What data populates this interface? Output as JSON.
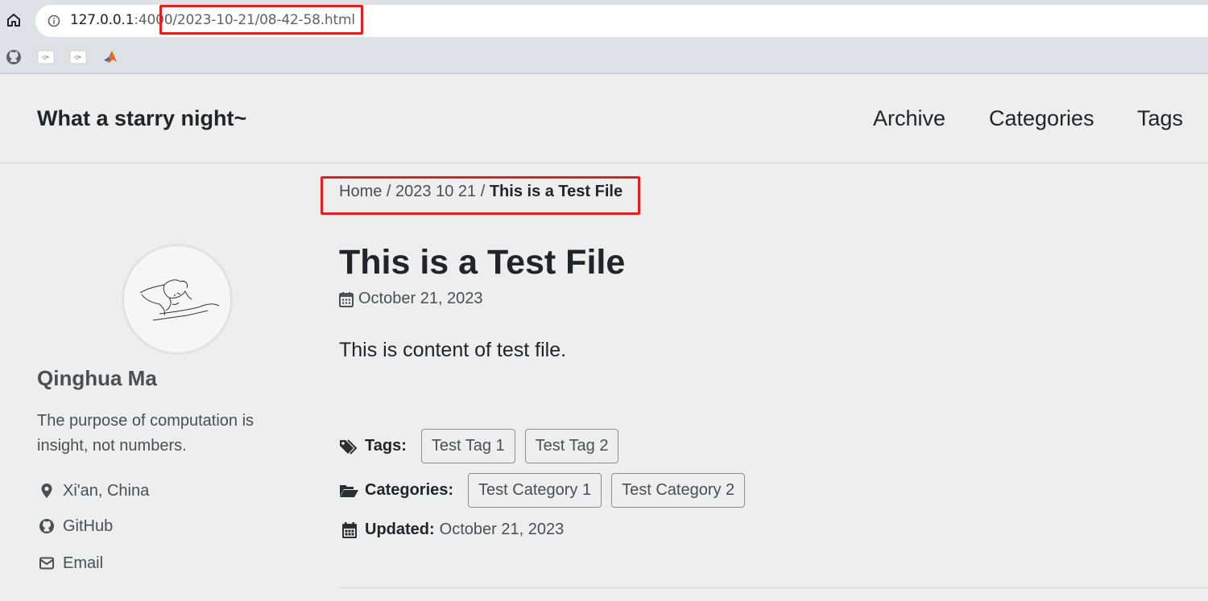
{
  "browser": {
    "url_host": "127.0.0.1",
    "url_port": ":4000",
    "url_path": "/2023-10-21/08-42-58.html"
  },
  "site": {
    "title": "What a starry night~",
    "nav": [
      "Archive",
      "Categories",
      "Tags"
    ]
  },
  "author": {
    "name": "Qinghua Ma",
    "bio": "The purpose of computation is insight, not numbers.",
    "links": [
      {
        "label": "Xi'an, China",
        "icon": "map-marker-icon"
      },
      {
        "label": "GitHub",
        "icon": "github-icon"
      },
      {
        "label": "Email",
        "icon": "envelope-icon"
      }
    ]
  },
  "breadcrumb": {
    "home": "Home",
    "separator": "/",
    "date": "2023 10 21",
    "current": "This is a Test File"
  },
  "post": {
    "title": "This is a Test File",
    "date": "October 21, 2023",
    "body": "This is content of test file.",
    "tags_label": "Tags:",
    "tags": [
      "Test Tag 1",
      "Test Tag 2"
    ],
    "categories_label": "Categories:",
    "categories": [
      "Test Category 1",
      "Test Category 2"
    ],
    "updated_label": "Updated:",
    "updated": "October 21, 2023"
  },
  "colors": {
    "highlight": "#e02020",
    "page_bg": "#eeeeee"
  }
}
